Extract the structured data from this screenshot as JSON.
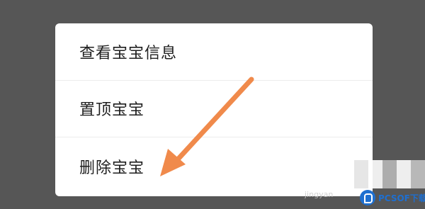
{
  "menu": {
    "items": [
      {
        "label": "查看宝宝信息"
      },
      {
        "label": "置顶宝宝"
      },
      {
        "label": "删除宝宝"
      }
    ]
  },
  "annotation": {
    "arrow_color": "#f08a4b",
    "points_to": "删除宝宝"
  },
  "watermark": {
    "left_text": "jingyan",
    "brand_text": "PCSOF下载"
  },
  "colors": {
    "overlay": "#565656",
    "card": "#ffffff",
    "text": "#1e1e1e",
    "divider": "#ececec",
    "watermark": "#1e6fd0"
  }
}
